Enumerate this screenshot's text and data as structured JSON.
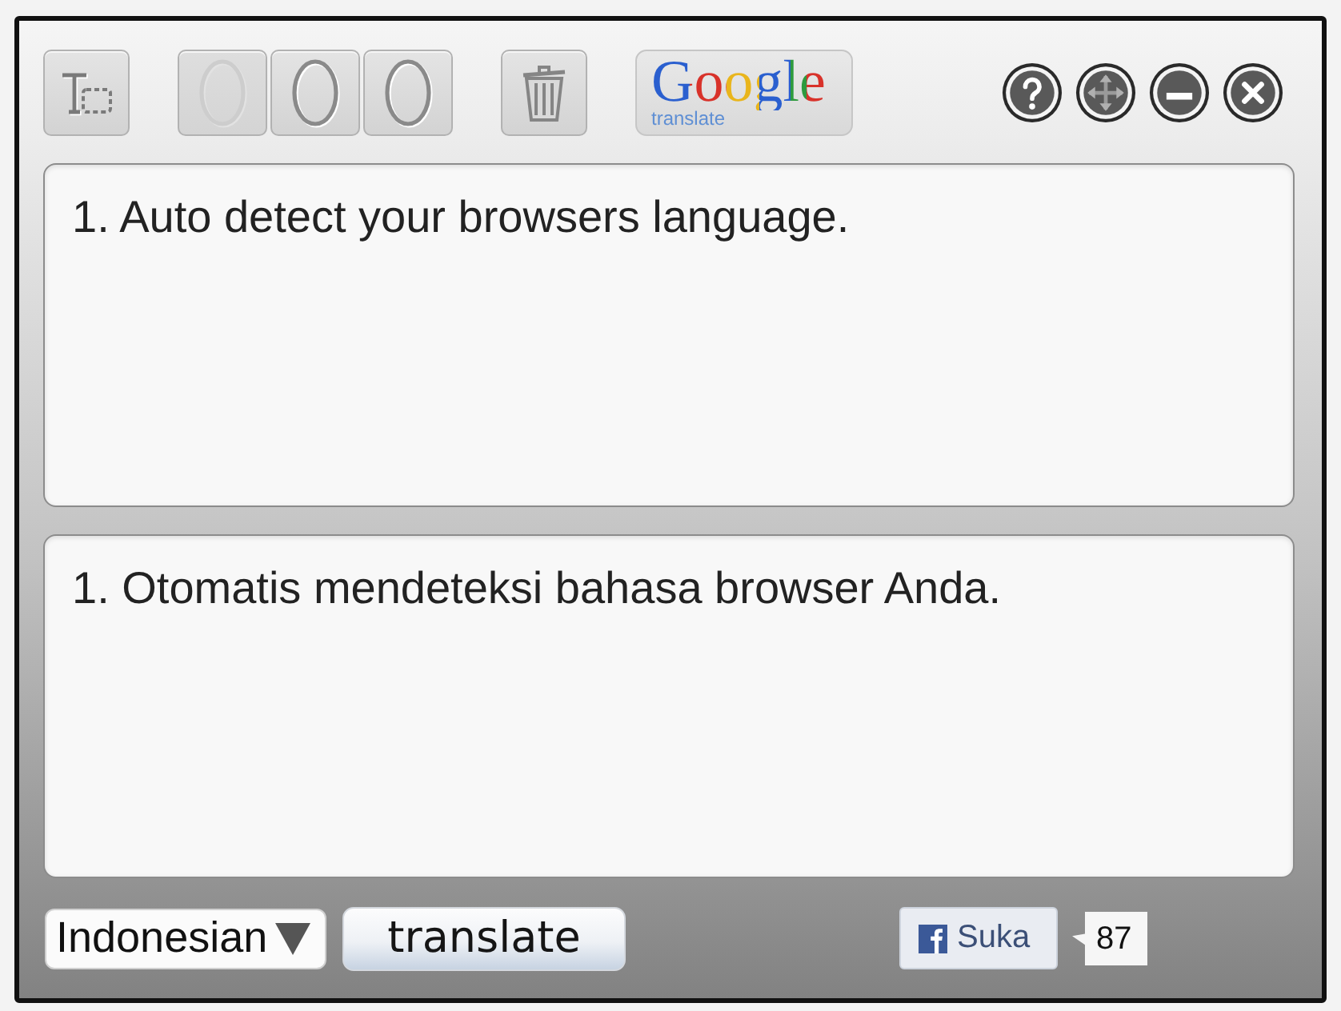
{
  "toolbar": {
    "buttons": [
      {
        "kind": "text-size",
        "disabled": false
      },
      {
        "kind": "oval",
        "disabled": true
      },
      {
        "kind": "oval",
        "disabled": false
      },
      {
        "kind": "oval",
        "disabled": false
      },
      {
        "kind": "trash",
        "disabled": false
      }
    ],
    "logo": {
      "wordmark": "Google",
      "subtitle": "translate"
    },
    "window_controls": [
      {
        "kind": "help"
      },
      {
        "kind": "move"
      },
      {
        "kind": "minimize"
      },
      {
        "kind": "close"
      }
    ]
  },
  "source": {
    "text": "1. Auto detect your browsers language."
  },
  "translation": {
    "text": "1. Otomatis mendeteksi bahasa browser Anda."
  },
  "footer": {
    "language": {
      "value": "Indonesian"
    },
    "translate_button": "translate",
    "like_button": {
      "label": "Suka",
      "count": "87"
    }
  }
}
